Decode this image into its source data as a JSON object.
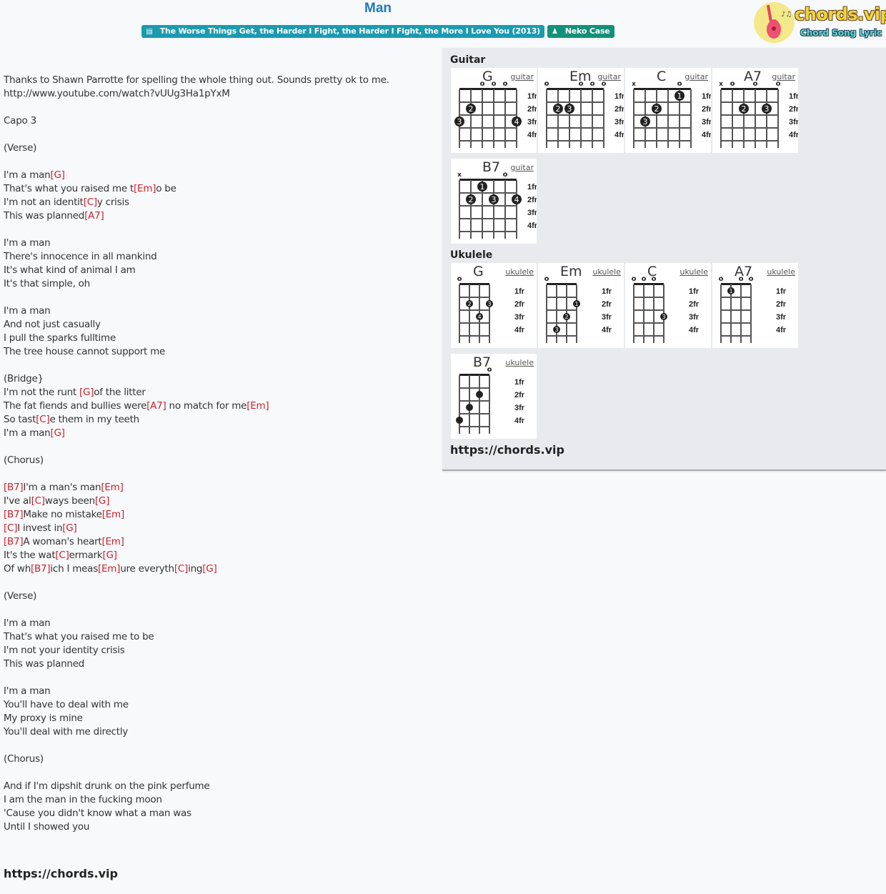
{
  "header": {
    "title": "Man",
    "album_badge": "The Worse Things Get, the Harder I Fight, the Harder I Fight, the More I Love You (2013)",
    "album_icon": "book-icon",
    "artist_badge": "Neko Case",
    "artist_icon": "user-icon"
  },
  "logo": {
    "brand": "chords.vip",
    "tagline": "Chord Song Lyric",
    "icon": "guitar-icon"
  },
  "colors": {
    "title": "#1f7bbd",
    "chord": "#d0202a",
    "album_badge": "#1a9bb0",
    "artist_badge": "#13907a",
    "panel_bg": "#e8eaed"
  },
  "lyrics": [
    [
      {
        "t": "Thanks to Shawn Parrotte for spelling the whole thing out. Sounds pretty ok to me."
      }
    ],
    [
      {
        "t": "http://www.youtube.com/watch?vUUg3Ha1pYxM"
      }
    ],
    [],
    [
      {
        "t": "Capo 3"
      }
    ],
    [],
    [
      {
        "t": "(Verse)"
      }
    ],
    [],
    [
      {
        "t": "I'm a man"
      },
      {
        "c": "[G]"
      }
    ],
    [
      {
        "t": "That's what you raised me t"
      },
      {
        "c": "[Em]"
      },
      {
        "t": "o be"
      }
    ],
    [
      {
        "t": "I'm not an identit"
      },
      {
        "c": "[C]"
      },
      {
        "t": "y crisis"
      }
    ],
    [
      {
        "t": "This was planned"
      },
      {
        "c": "[A7]"
      }
    ],
    [],
    [
      {
        "t": "I'm a man"
      }
    ],
    [
      {
        "t": "There's innocence in all mankind"
      }
    ],
    [
      {
        "t": "It's what kind of animal I am"
      }
    ],
    [
      {
        "t": "It's that simple, oh"
      }
    ],
    [],
    [
      {
        "t": "I'm a man"
      }
    ],
    [
      {
        "t": "And not just casually"
      }
    ],
    [
      {
        "t": "I pull the sparks fulltime"
      }
    ],
    [
      {
        "t": "The tree house cannot support me"
      }
    ],
    [],
    [
      {
        "t": "(Bridge}"
      }
    ],
    [
      {
        "t": "I'm not the runt "
      },
      {
        "c": "[G]"
      },
      {
        "t": "of the litter"
      }
    ],
    [
      {
        "t": "The fat fiends and bullies were"
      },
      {
        "c": "[A7]"
      },
      {
        "t": " no match for me"
      },
      {
        "c": "[Em]"
      }
    ],
    [
      {
        "t": "So tast"
      },
      {
        "c": "[C]"
      },
      {
        "t": "e them in my teeth"
      }
    ],
    [
      {
        "t": "I'm a man"
      },
      {
        "c": "[G]"
      }
    ],
    [],
    [
      {
        "t": "(Chorus)"
      }
    ],
    [],
    [
      {
        "c": "[B7]"
      },
      {
        "t": "I'm a man's man"
      },
      {
        "c": "[Em]"
      }
    ],
    [
      {
        "t": "I've al"
      },
      {
        "c": "[C]"
      },
      {
        "t": "ways been"
      },
      {
        "c": "[G]"
      }
    ],
    [
      {
        "c": "[B7]"
      },
      {
        "t": "Make no mistake"
      },
      {
        "c": "[Em]"
      }
    ],
    [
      {
        "c": "[C]"
      },
      {
        "t": "I invest in"
      },
      {
        "c": "[G]"
      }
    ],
    [
      {
        "c": "[B7]"
      },
      {
        "t": "A woman's heart"
      },
      {
        "c": "[Em]"
      }
    ],
    [
      {
        "t": "It's the wat"
      },
      {
        "c": "[C]"
      },
      {
        "t": "ermark"
      },
      {
        "c": "[G]"
      }
    ],
    [
      {
        "t": "Of wh"
      },
      {
        "c": "[B7]"
      },
      {
        "t": "ich I meas"
      },
      {
        "c": "[Em]"
      },
      {
        "t": "ure everyth"
      },
      {
        "c": "[C]"
      },
      {
        "t": "ing"
      },
      {
        "c": "[G]"
      }
    ],
    [],
    [
      {
        "t": "(Verse)"
      }
    ],
    [],
    [
      {
        "t": "I'm a man"
      }
    ],
    [
      {
        "t": "That's what you raised me to be"
      }
    ],
    [
      {
        "t": "I'm not your identity crisis"
      }
    ],
    [
      {
        "t": "This was planned"
      }
    ],
    [],
    [
      {
        "t": "I'm a man"
      }
    ],
    [
      {
        "t": "You'll have to deal with me"
      }
    ],
    [
      {
        "t": "My proxy is mine"
      }
    ],
    [
      {
        "t": "You'll deal with me directly"
      }
    ],
    [],
    [
      {
        "t": "(Chorus)"
      }
    ],
    [],
    [
      {
        "t": "And if I'm dipshit drunk on the pink perfume"
      }
    ],
    [
      {
        "t": "I am the man in the fucking moon"
      }
    ],
    [
      {
        "t": "'Cause you didn't know what a man was"
      }
    ],
    [
      {
        "t": "Until I showed you"
      }
    ]
  ],
  "lyrics_footer": "https://chords.vip",
  "panel": {
    "guitar_title": "Guitar",
    "ukulele_title": "Ukulele",
    "footer": "https://chords.vip",
    "fret_labels": [
      "1fr",
      "2fr",
      "3fr",
      "4fr"
    ],
    "guitar": [
      {
        "name": "G",
        "link": "guitar",
        "marks": [
          "",
          "",
          "o",
          "o",
          "o",
          ""
        ],
        "dots": [
          [
            1,
            2,
            "2"
          ],
          [
            0,
            3,
            "3"
          ],
          [
            5,
            3,
            "4"
          ]
        ]
      },
      {
        "name": "Em",
        "link": "guitar",
        "marks": [
          "o",
          "",
          "",
          "o",
          "o",
          "o"
        ],
        "dots": [
          [
            1,
            2,
            "2"
          ],
          [
            2,
            2,
            "3"
          ]
        ]
      },
      {
        "name": "C",
        "link": "guitar",
        "marks": [
          "x",
          "",
          "",
          "",
          "o",
          ""
        ],
        "dots": [
          [
            4,
            1,
            "1"
          ],
          [
            2,
            2,
            "2"
          ],
          [
            1,
            3,
            "3"
          ]
        ]
      },
      {
        "name": "A7",
        "link": "guitar",
        "marks": [
          "x",
          "o",
          "",
          "o",
          "",
          "o"
        ],
        "dots": [
          [
            2,
            2,
            "2"
          ],
          [
            4,
            2,
            "3"
          ]
        ]
      },
      {
        "name": "B7",
        "link": "guitar",
        "marks": [
          "x",
          "",
          "",
          "",
          "o",
          ""
        ],
        "dots": [
          [
            2,
            1,
            "1"
          ],
          [
            1,
            2,
            "2"
          ],
          [
            3,
            2,
            "3"
          ],
          [
            5,
            2,
            "4"
          ]
        ]
      }
    ],
    "ukulele": [
      {
        "name": "G",
        "link": "ukulele",
        "marks": [
          "o",
          "",
          "",
          ""
        ],
        "dots": [
          [
            1,
            2,
            "2"
          ],
          [
            3,
            2,
            "3"
          ],
          [
            2,
            3,
            "4"
          ]
        ]
      },
      {
        "name": "Em",
        "link": "ukulele",
        "marks": [
          "o",
          "",
          "",
          ""
        ],
        "dots": [
          [
            3,
            2,
            "1"
          ],
          [
            2,
            3,
            "2"
          ],
          [
            1,
            4,
            "3"
          ]
        ]
      },
      {
        "name": "C",
        "link": "ukulele",
        "marks": [
          "o",
          "o",
          "o",
          ""
        ],
        "dots": [
          [
            3,
            3,
            "3"
          ]
        ]
      },
      {
        "name": "A7",
        "link": "ukulele",
        "marks": [
          "o",
          "",
          "o",
          "o"
        ],
        "dots": [
          [
            1,
            1,
            "1"
          ]
        ]
      },
      {
        "name": "B7",
        "link": "ukulele",
        "marks": [
          "",
          "",
          "",
          "o"
        ],
        "dots": [
          [
            2,
            2,
            ""
          ],
          [
            1,
            3,
            ""
          ],
          [
            0,
            4,
            ""
          ]
        ]
      }
    ]
  }
}
